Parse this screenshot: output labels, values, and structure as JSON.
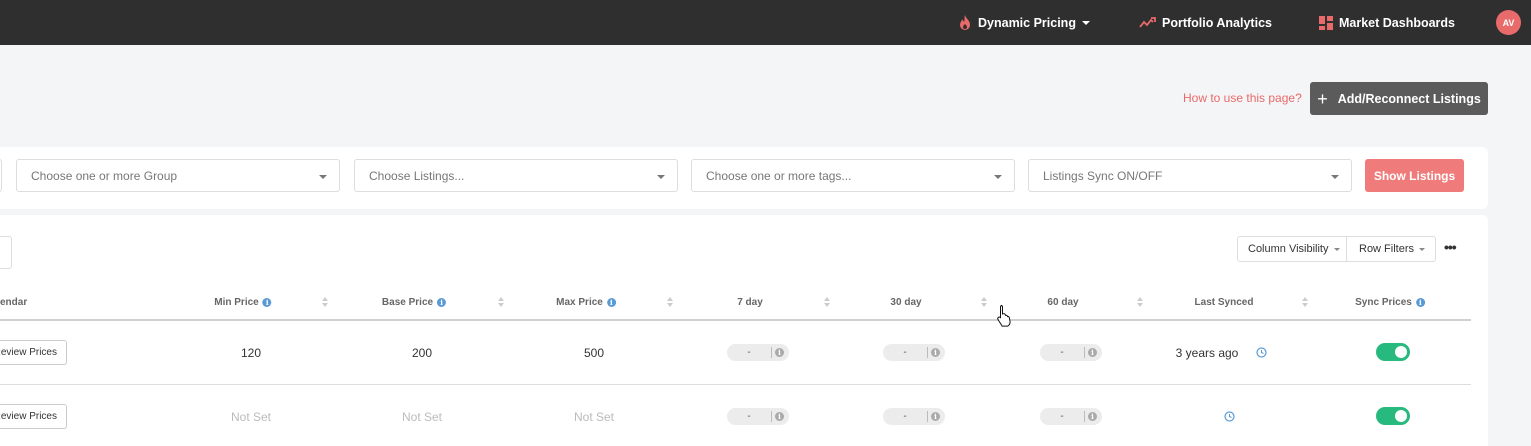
{
  "nav": {
    "dynamic_pricing": "Dynamic Pricing",
    "portfolio_analytics": "Portfolio Analytics",
    "market_dashboards": "Market Dashboards",
    "avatar_initials": "AV",
    "accent_color": "#e96a6a"
  },
  "header": {
    "how_to": "How to use this page?",
    "add_button": "Add/Reconnect Listings"
  },
  "filters": {
    "group_placeholder": "Choose one or more Group",
    "listings_placeholder": "Choose Listings...",
    "tags_placeholder": "Choose one or more tags...",
    "sync_placeholder": "Listings Sync ON/OFF",
    "show_button": "Show Listings"
  },
  "toolbar": {
    "column_visibility": "Column Visibility",
    "row_filters": "Row Filters"
  },
  "table": {
    "columns": {
      "calendar": "endar",
      "min_price": "Min Price",
      "base_price": "Base Price",
      "max_price": "Max Price",
      "d7": "7 day",
      "d30": "30 day",
      "d60": "60 day",
      "last_synced": "Last Synced",
      "sync_prices": "Sync Prices"
    },
    "rows": [
      {
        "review": "Review Prices",
        "min_price": "120",
        "base_price": "200",
        "max_price": "500",
        "d7": "-",
        "d30": "-",
        "d60": "-",
        "last_synced": "3 years ago",
        "sync_on": true
      },
      {
        "review": "Review Prices",
        "min_price": "Not Set",
        "base_price": "Not Set",
        "max_price": "Not Set",
        "d7": "-",
        "d30": "-",
        "d60": "-",
        "last_synced": "",
        "sync_on": true
      }
    ]
  },
  "icons": [
    "flame-icon",
    "trend-icon",
    "dashboard-icon",
    "info-icon",
    "clock-icon",
    "more-icon",
    "plus-icon",
    "hand-cursor-icon"
  ],
  "colors": {
    "toggle_on": "#27b97d",
    "show_button": "#f07b7b",
    "info": "#5b9bd5"
  }
}
